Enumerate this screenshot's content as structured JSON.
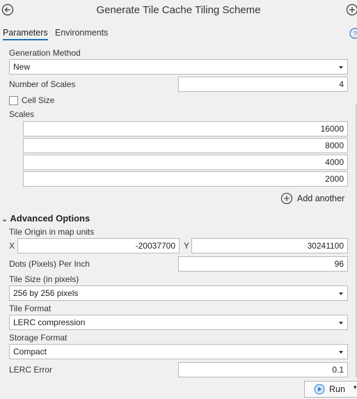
{
  "title": "Generate Tile Cache Tiling Scheme",
  "tabs": [
    {
      "label": "Parameters",
      "active": true
    },
    {
      "label": "Environments",
      "active": false
    }
  ],
  "generation_method": {
    "label": "Generation Method",
    "value": "New"
  },
  "number_of_scales": {
    "label": "Number of Scales",
    "value": "4"
  },
  "cell_size": {
    "label": "Cell Size",
    "checked": false
  },
  "scales": {
    "label": "Scales",
    "values": [
      "16000",
      "8000",
      "4000",
      "2000"
    ]
  },
  "add_another": {
    "label": "Add another"
  },
  "advanced": {
    "label": "Advanced Options",
    "tile_origin": {
      "label": "Tile Origin in map units",
      "x_label": "X",
      "x_value": "-20037700",
      "y_label": "Y",
      "y_value": "30241100"
    },
    "dpi": {
      "label": "Dots (Pixels) Per Inch",
      "value": "96"
    },
    "tile_size": {
      "label": "Tile Size (in pixels)",
      "value": "256 by 256 pixels"
    },
    "tile_format": {
      "label": "Tile Format",
      "value": "LERC compression"
    },
    "storage_format": {
      "label": "Storage Format",
      "value": "Compact"
    },
    "lerc_error": {
      "label": "LERC Error",
      "value": "0.1"
    }
  },
  "run": {
    "label": "Run"
  },
  "colors": {
    "accent": "#1e6fb8",
    "background": "#f0f0f0"
  }
}
